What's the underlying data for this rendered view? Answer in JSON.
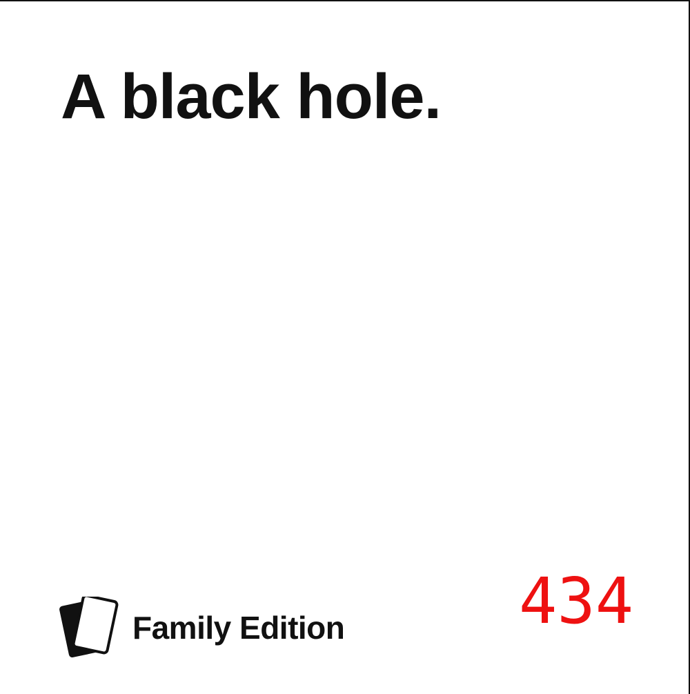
{
  "card": {
    "text": "A black hole.",
    "edition": "Family Edition",
    "number": "434"
  },
  "logo": {
    "icon": "two-cards-icon"
  },
  "colors": {
    "text": "#111111",
    "number": "#ee1111",
    "background": "#ffffff"
  }
}
